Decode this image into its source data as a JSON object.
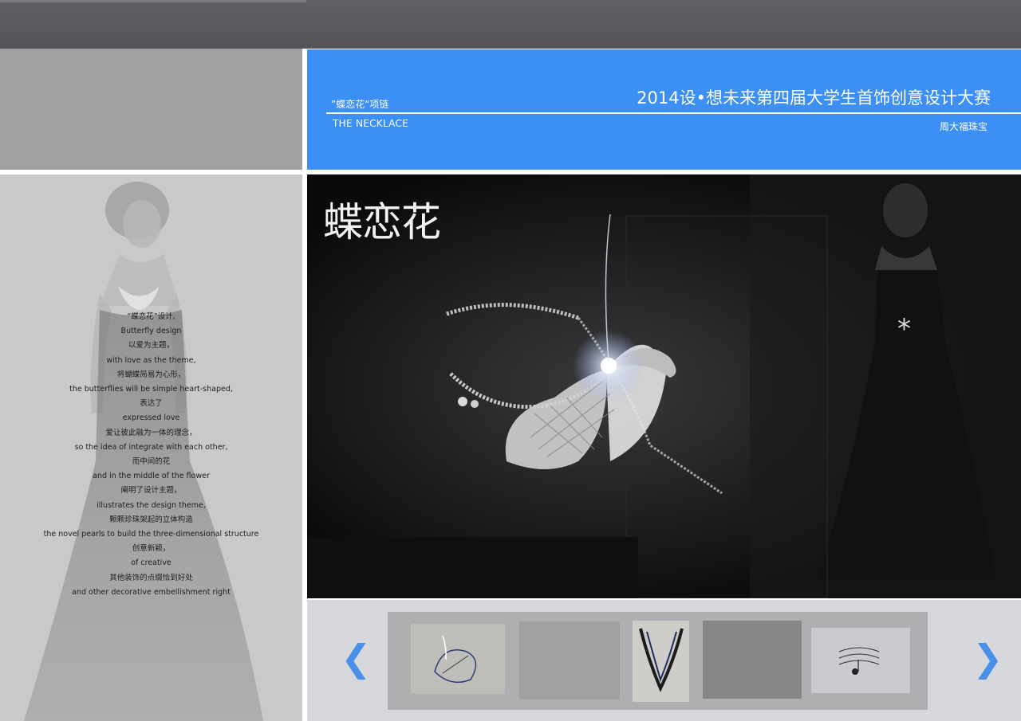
{
  "header": {
    "subtitle": "”蝶恋花“项链",
    "necklace_label": "THE NECKLACE",
    "competition_title": "2014设•想未来第四届大学生首饰创意设计大赛",
    "brand": "周大福珠宝"
  },
  "main_image": {
    "logo_text": "蝶恋花"
  },
  "story": {
    "lines": [
      "“蝶恋花”设计,",
      "Butterfly design",
      "以爱为主题，",
      "with love as the theme,",
      "将蝴蝶简易为心形，",
      "the butterflies will be simple heart-shaped,",
      "表达了",
      "expressed love",
      "爱让彼此融为一体的理念，",
      "so the idea  of integrate with each other,",
      "而中间的花",
      "and in the middle of the flower",
      "阐明了设计主题，",
      "illustrates the design theme,",
      "颗颗珍珠架起的立体构造",
      "the novel pearls to build the three-dimensional structure",
      "创意新颖，",
      "of creative",
      "其他装饰的点缀恰到好处",
      "and other decorative embellishment right"
    ]
  },
  "carousel": {
    "prev_icon": "chevron-left-icon",
    "next_icon": "chevron-right-icon",
    "prev_glyph": "❮",
    "next_glyph": "❯"
  },
  "colors": {
    "accent_blue": "#3b8ff5",
    "top_bar": "#58595c",
    "panel_gray": "#a1a1a1",
    "story_bg": "#c9c9ca",
    "carousel_bg": "#d6d8db"
  }
}
